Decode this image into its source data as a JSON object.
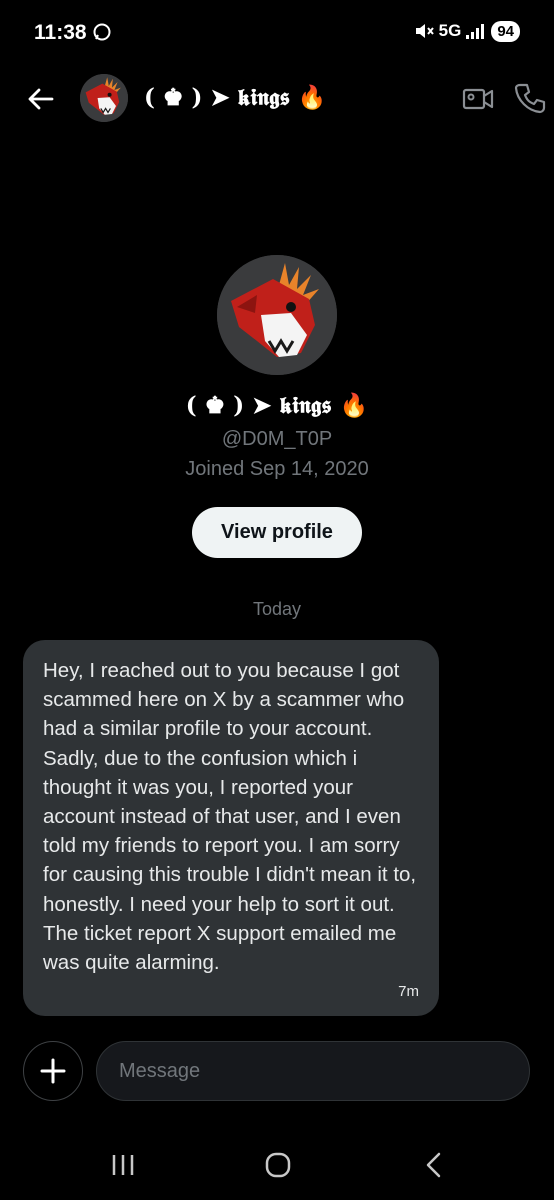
{
  "status_bar": {
    "time": "11:38",
    "network": "5G",
    "battery": "94"
  },
  "header": {
    "name": "( ♚ ) ➤ 𝖐𝖎𝖓𝖌𝖘 🔥"
  },
  "profile": {
    "name": "( ♚ ) ➤ 𝖐𝖎𝖓𝖌𝖘 🔥",
    "handle": "@D0M_T0P",
    "joined": "Joined Sep 14, 2020",
    "view_profile_label": "View profile"
  },
  "conversation": {
    "date_divider": "Today",
    "messages": [
      {
        "text": "Hey, I reached out to you because I got scammed here on X by a scammer who had a similar profile to your account. Sadly, due to the confusion which i thought it was you, I reported your account instead of that user, and I even told my friends to report you. I am sorry for causing this trouble I didn't mean it to, honestly. I need your help to sort it out. The ticket report X support emailed me was quite alarming.",
        "time": "7m"
      }
    ]
  },
  "composer": {
    "placeholder": "Message"
  },
  "icons": {
    "back": "arrow-left-icon",
    "video": "video-camera-icon",
    "call": "phone-icon",
    "add": "plus-icon",
    "chat_status": "chat-bubble-icon",
    "mute": "mute-icon",
    "signal": "signal-bars-icon",
    "nav_recents": "recents-icon",
    "nav_home": "home-icon",
    "nav_back": "chevron-left-icon"
  },
  "colors": {
    "background": "#000000",
    "bubble": "#2f3336",
    "muted_text": "#71767b",
    "button_bg": "#eff3f4"
  }
}
